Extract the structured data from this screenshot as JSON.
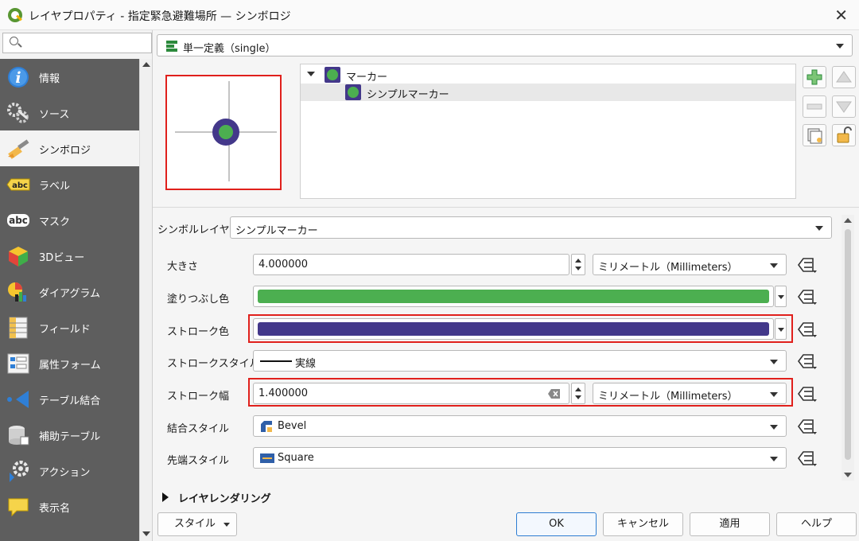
{
  "window": {
    "title": "レイヤプロパティ - 指定緊急避難場所 — シンボロジ"
  },
  "sidebar": {
    "search_placeholder": "",
    "items": [
      {
        "label": "情報",
        "icon": "info-icon"
      },
      {
        "label": "ソース",
        "icon": "source-icon"
      },
      {
        "label": "シンボロジ",
        "icon": "symbology-brush-icon"
      },
      {
        "label": "ラベル",
        "icon": "labels-icon"
      },
      {
        "label": "マスク",
        "icon": "mask-icon"
      },
      {
        "label": "3Dビュー",
        "icon": "3d-view-icon"
      },
      {
        "label": "ダイアグラム",
        "icon": "diagram-icon"
      },
      {
        "label": "フィールド",
        "icon": "fields-icon"
      },
      {
        "label": "属性フォーム",
        "icon": "attribute-form-icon"
      },
      {
        "label": "テーブル結合",
        "icon": "joins-icon"
      },
      {
        "label": "補助テーブル",
        "icon": "auxiliary-storage-icon"
      },
      {
        "label": "アクション",
        "icon": "actions-icon"
      },
      {
        "label": "表示名",
        "icon": "display-icon"
      }
    ],
    "icon_texts": {
      "labels": "abc",
      "mask": "abc"
    }
  },
  "renderer": {
    "value": "単一定義（single）"
  },
  "symbol_tree": {
    "root": "マーカー",
    "child": "シンプルマーカー"
  },
  "properties": {
    "symbol_layer_type_label": "シンボルレイヤ型",
    "symbol_layer_type_value": "シンプルマーカー",
    "size_label": "大きさ",
    "size_value": "4.000000",
    "size_unit": "ミリメートル（Millimeters）",
    "fill_color_label": "塗りつぶし色",
    "fill_color": "#4caf50",
    "stroke_color_label": "ストローク色",
    "stroke_color": "#43388a",
    "stroke_style_label": "ストロークスタイル",
    "stroke_style_value": "実線",
    "stroke_width_label": "ストローク幅",
    "stroke_width_value": "1.400000",
    "stroke_width_unit": "ミリメートル（Millimeters）",
    "join_style_label": "結合スタイル",
    "join_style_value": "Bevel",
    "cap_style_label": "先端スタイル",
    "cap_style_value": "Square"
  },
  "layer_rendering": {
    "label": "レイヤレンダリング"
  },
  "footer": {
    "style_label": "スタイル",
    "ok_label": "OK",
    "cancel_label": "キャンセル",
    "apply_label": "適用",
    "help_label": "ヘルプ"
  }
}
